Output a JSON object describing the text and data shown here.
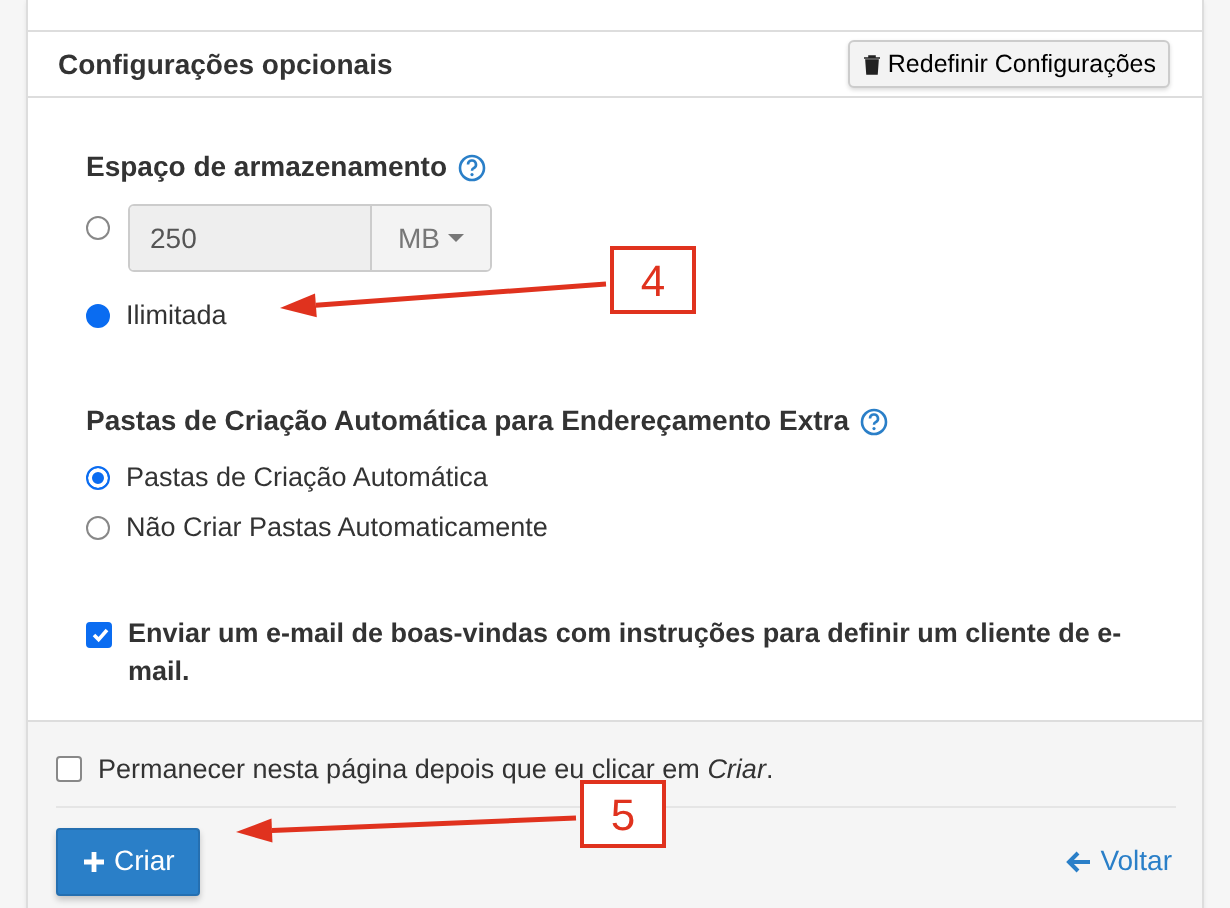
{
  "header": {
    "title": "Configurações opcionais",
    "reset_button": "Redefinir Configurações"
  },
  "storage": {
    "label": "Espaço de armazenamento",
    "options": [
      {
        "kind": "quota",
        "selected": false,
        "value": "250",
        "unit": "MB"
      },
      {
        "kind": "text",
        "selected": true,
        "label": "Ilimitada"
      }
    ]
  },
  "folders": {
    "label": "Pastas de Criação Automática para Endereçamento Extra",
    "options": [
      {
        "label": "Pastas de Criação Automática",
        "selected": true
      },
      {
        "label": "Não Criar Pastas Automaticamente",
        "selected": false
      }
    ]
  },
  "welcome_email": {
    "label": "Enviar um e-mail de boas-vindas com instruções para definir um cliente de e-mail.",
    "checked": true
  },
  "footer": {
    "stay_on_page": {
      "label": "Permanecer nesta página depois que eu clicar em *Criar*.",
      "checked": false
    },
    "create_button": "Criar",
    "back_link": "Voltar"
  },
  "annotations": [
    {
      "label": "4"
    },
    {
      "label": "5"
    }
  ]
}
